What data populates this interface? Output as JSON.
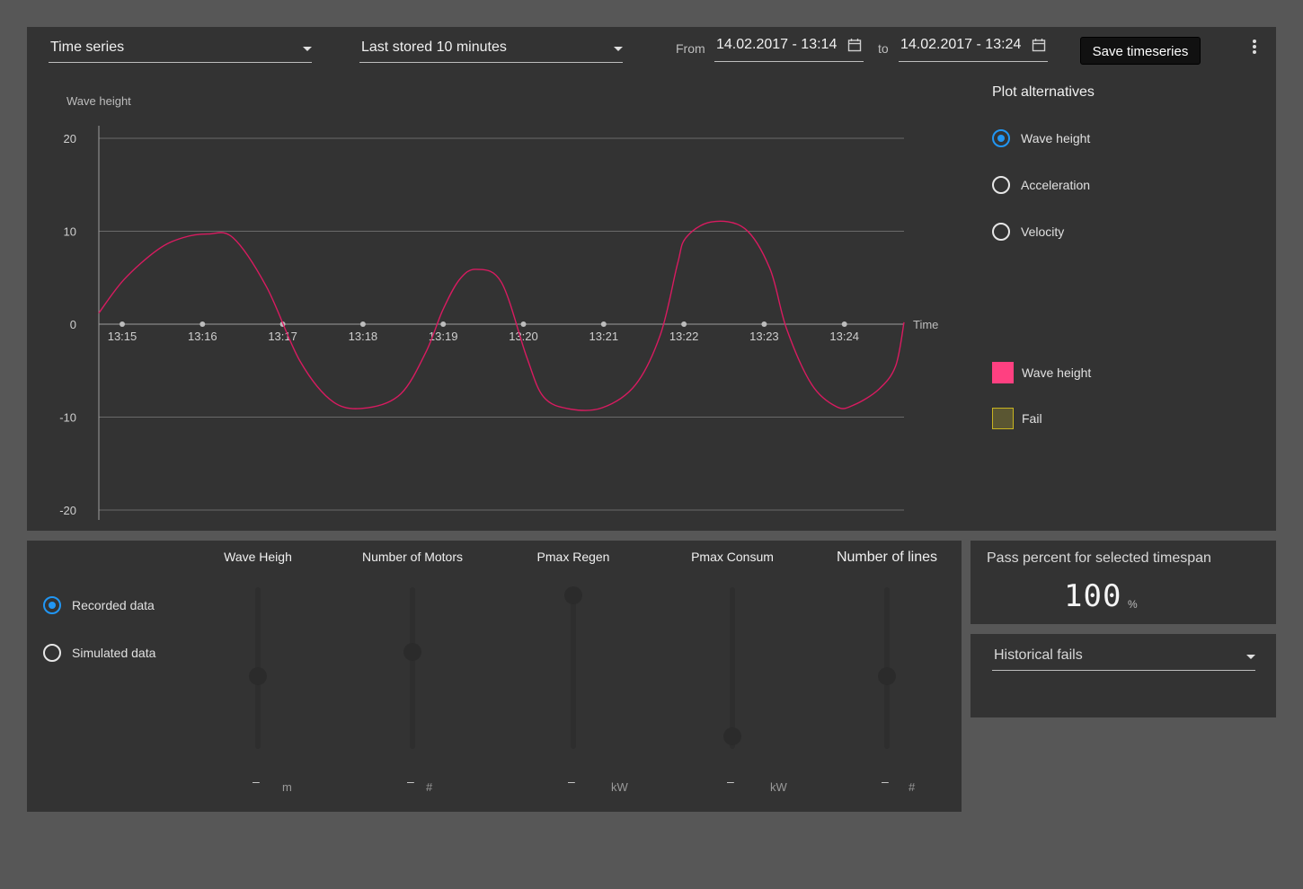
{
  "toolbar": {
    "view_select": "Time series",
    "range_select": "Last stored 10 minutes",
    "from_label": "From",
    "from_value": "14.02.2017 - 13:14",
    "to_label": "to",
    "to_value": "14.02.2017 - 13:24",
    "save_label": "Save timeseries"
  },
  "plot_alternatives": {
    "title": "Plot alternatives",
    "options": [
      {
        "label": "Wave height",
        "selected": true
      },
      {
        "label": "Acceleration",
        "selected": false
      },
      {
        "label": "Velocity",
        "selected": false
      }
    ]
  },
  "legend": [
    {
      "label": "Wave height",
      "color": "#ff4081"
    },
    {
      "label": "Fail",
      "color": "#5a5632"
    }
  ],
  "chart_data": {
    "type": "line",
    "ylabel": "Wave height",
    "xlabel": "Time",
    "ylim": [
      -20,
      20
    ],
    "yticks": [
      20,
      10,
      0,
      -10,
      -20
    ],
    "xticks": [
      "13:15",
      "13:16",
      "13:17",
      "13:18",
      "13:19",
      "13:20",
      "13:21",
      "13:22",
      "13:23",
      "13:24"
    ],
    "grid": true,
    "series": [
      {
        "name": "Wave height",
        "color": "#d81b60",
        "x": [
          0,
          0.3,
          0.7,
          1.0,
          1.3,
          1.6,
          2.0,
          2.4,
          2.8,
          3.2,
          3.6,
          3.9,
          4.1,
          4.3,
          4.5,
          4.8,
          5.1,
          5.3,
          5.6,
          6.0,
          6.4,
          6.7,
          6.9,
          7.0,
          7.3,
          7.7,
          8.0,
          8.2,
          8.5,
          8.8,
          9.0,
          9.3,
          9.5,
          9.6
        ],
        "y": [
          1.2,
          4.8,
          8.0,
          9.3,
          9.7,
          9.3,
          4.0,
          -4.0,
          -8.4,
          -9.0,
          -7.5,
          -3.0,
          1.5,
          4.8,
          5.9,
          4.5,
          -3.5,
          -7.8,
          -9.1,
          -9.0,
          -6.5,
          -1.0,
          6.5,
          9.3,
          11.0,
          10.3,
          6.0,
          -0.5,
          -6.5,
          -8.9,
          -8.7,
          -7.0,
          -4.5,
          0.2
        ]
      }
    ],
    "time_points": [
      "13:15",
      "13:16",
      "13:17",
      "13:18",
      "13:19",
      "13:20",
      "13:21",
      "13:22",
      "13:23",
      "13:24"
    ]
  },
  "data_source": {
    "options": [
      {
        "label": "Recorded data",
        "selected": true
      },
      {
        "label": "Simulated data",
        "selected": false
      }
    ]
  },
  "sliders": [
    {
      "title": "Wave Heigh",
      "value": "–",
      "unit": "m",
      "level": 0.45
    },
    {
      "title": "Number of Motors",
      "value": "–",
      "unit": "#",
      "level": 0.6
    },
    {
      "title": "Pmax Regen",
      "value": "–",
      "unit": "kW",
      "level": 0.95
    },
    {
      "title": "Pmax Consum",
      "value": "–",
      "unit": "kW",
      "level": 0.08
    },
    {
      "title": "Number of lines",
      "value": "–",
      "unit": "#",
      "level": 0.45
    }
  ],
  "pass": {
    "title": "Pass percent for selected timespan",
    "value": "100",
    "unit": "%"
  },
  "fails": {
    "select": "Historical fails"
  },
  "colors": {
    "accent": "#2196f3",
    "panel": "#333333",
    "background": "#575757"
  }
}
